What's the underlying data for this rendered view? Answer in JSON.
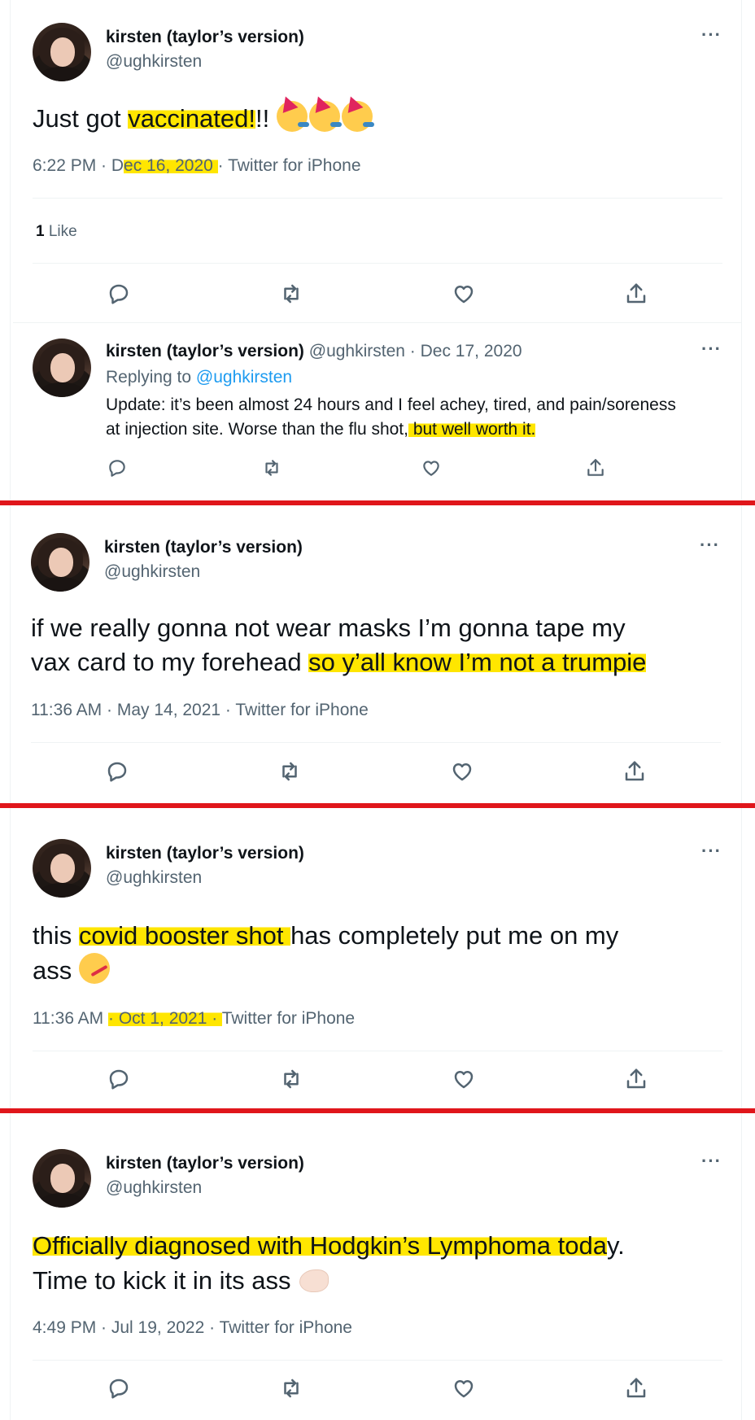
{
  "tweets": [
    {
      "name": "kirsten (taylor’s version)",
      "handle": "@ughkirsten",
      "text_parts": [
        "Just got ",
        "vaccinated!",
        "!! "
      ],
      "time": "6:22 PM · D",
      "date_highlight": "ec 16, 2020 ",
      "meta_rest": "· Twitter for iPhone",
      "likes_count": "1",
      "likes_label": " Like",
      "emojis": [
        "party-face-icon",
        "party-face-icon",
        "party-face-icon"
      ]
    },
    {
      "name": "kirsten (taylor’s version)",
      "handle": "@ughkirsten",
      "text_line1": "if we really gonna not wear masks I’m gonna tape my",
      "text_line2_plain": "vax card to my forehead ",
      "text_line2_highlight": "so y’all know I’m not a trumpie",
      "meta": "11:36 AM · May 14, 2021 · Twitter for iPhone"
    },
    {
      "name": "kirsten (taylor’s version)",
      "handle": "@ughkirsten",
      "text_plain1": "this ",
      "text_highlight": "covid booster shot ",
      "text_plain2": "has completely put me on my",
      "text_line2": "ass ",
      "meta_time": "11:36 AM ",
      "meta_highlight": "· Oct 1, 2021 · ",
      "meta_rest": "Twitter for iPhone",
      "emojis": [
        "thermometer-face-icon"
      ]
    },
    {
      "name": "kirsten (taylor’s version)",
      "handle": "@ughkirsten",
      "text_highlight": "Officially diagnosed with Hodgkin’s Lymphoma toda",
      "text_plain1": "y.",
      "text_line2": "Time to kick it in its ass ",
      "meta": "4:49 PM · Jul 19, 2022 · Twitter for iPhone",
      "emojis": [
        "flexed-biceps-icon"
      ]
    }
  ],
  "reply": {
    "name": "kirsten (taylor’s version)",
    "handle_date": " @ughkirsten · Dec 17, 2020",
    "replying_to": "Replying to ",
    "replying_handle": "@ughkirsten",
    "line1": "Update: it’s been almost 24 hours and I feel achey, tired, and pain/soreness",
    "line2_plain": "at injection site. Worse than the flu shot,",
    "line2_highlight": " but well worth it. "
  },
  "more_label": "···",
  "colors": {
    "highlight": "#ffe600",
    "separator": "#e0161b",
    "link": "#1d9bf0",
    "muted": "#536471"
  }
}
